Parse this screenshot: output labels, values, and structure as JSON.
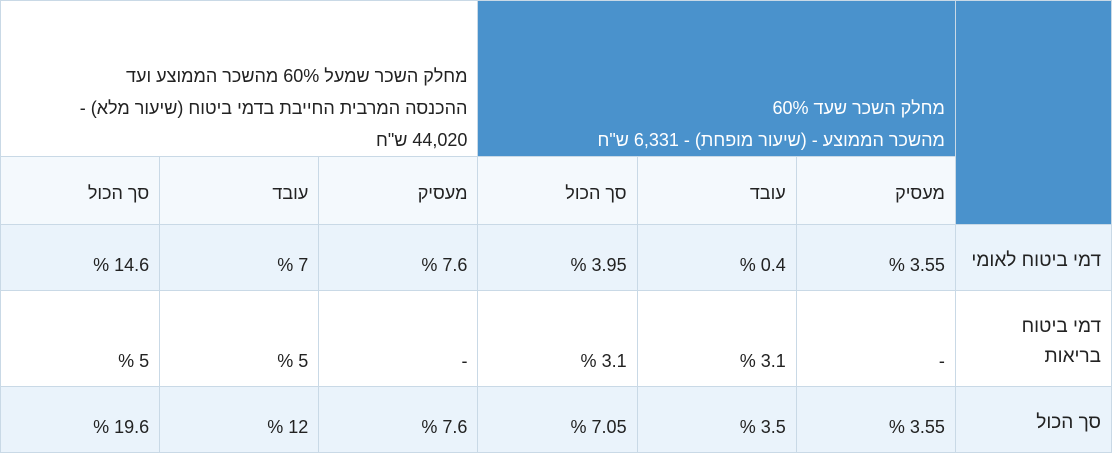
{
  "table": {
    "group_reduced": {
      "line1": "מחלק השכר שעד 60%",
      "line2": "מהשכר הממוצע - (שיעור מופחת) - 6,331 ש\"ח"
    },
    "group_full": {
      "line1": "מחלק השכר שמעל 60% מהשכר הממוצע ועד",
      "line2": "ההכנסה המרבית החייבת בדמי ביטוח (שיעור מלא) -",
      "line3": "44,020 ש\"ח"
    },
    "subheaders": [
      "מעסיק",
      "עובד",
      "סך הכול",
      "מעסיק",
      "עובד",
      "סך הכול"
    ],
    "rows": [
      {
        "label": "דמי ביטוח לאומי",
        "cells": [
          "3.55 %",
          "0.4 %",
          "3.95 %",
          "7.6 %",
          "7 %",
          "14.6 %"
        ]
      },
      {
        "label": "דמי ביטוח בריאות",
        "cells": [
          "-",
          "3.1 %",
          "3.1 %",
          "-",
          "5 %",
          "5 %"
        ]
      },
      {
        "label": "סך הכול",
        "cells": [
          "3.55 %",
          "3.5 %",
          "7.05 %",
          "7.6 %",
          "12 %",
          "19.6 %"
        ]
      }
    ]
  }
}
